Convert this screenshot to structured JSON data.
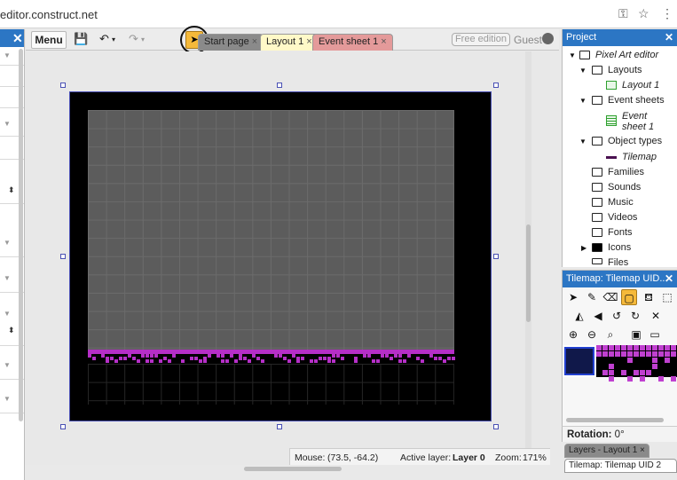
{
  "browser": {
    "url": "editor.construct.net",
    "key_icon": "key-icon",
    "star_icon": "star-icon",
    "more_icon": "more-vert-icon"
  },
  "toolbar": {
    "menu_label": "Menu",
    "tabs": [
      {
        "label": "Start page",
        "close": "×"
      },
      {
        "label": "Layout 1",
        "close": "×"
      },
      {
        "label": "Event sheet 1",
        "close": "×"
      }
    ],
    "free_edition": "Free edition",
    "guest": "Guest"
  },
  "project": {
    "title": "Project",
    "close": "✕",
    "items": [
      {
        "label": "Pixel Art editor"
      },
      {
        "label": "Layouts"
      },
      {
        "label": "Layout 1"
      },
      {
        "label": "Event sheets"
      },
      {
        "label": "Event",
        "label2": "sheet 1"
      },
      {
        "label": "Object types"
      },
      {
        "label": "Tilemap"
      },
      {
        "label": "Families"
      },
      {
        "label": "Sounds"
      },
      {
        "label": "Music"
      },
      {
        "label": "Videos"
      },
      {
        "label": "Fonts"
      },
      {
        "label": "Icons"
      },
      {
        "label": "Files"
      }
    ]
  },
  "tilemap_panel": {
    "title": "Tilemap: Tilemap UID...",
    "close": "✕"
  },
  "rotation": {
    "label": "Rotation:",
    "value": "0°"
  },
  "bottom_tabs": {
    "layers": "Layers - Layout 1",
    "layers_close": "×",
    "tilemap": "Tilemap: Tilemap UID 2"
  },
  "status": {
    "mouse_label": "Mouse:",
    "mouse_value": "(73.5, -64.2)",
    "active_layer_label": "Active layer:",
    "active_layer_value": "Layer 0",
    "zoom_label": "Zoom:",
    "zoom_value": "171%"
  },
  "colors": {
    "panel_header": "#2c76c4",
    "tile_purple": "#b52fc7",
    "active_tool": "#f5b93a",
    "layout_bg": "#000000"
  }
}
